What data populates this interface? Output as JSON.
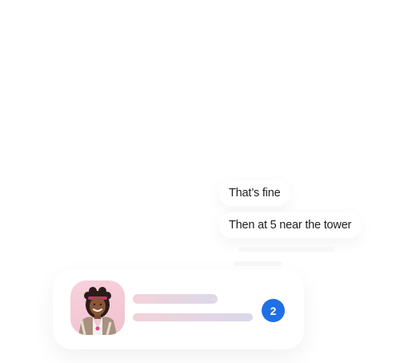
{
  "messages": [
    {
      "text": "That’s fine"
    },
    {
      "text": "Then at 5 near the tower"
    }
  ],
  "conversation_card": {
    "unread_count": "2",
    "accent_color": "#1f6fe5",
    "avatar": "person-portrait"
  }
}
